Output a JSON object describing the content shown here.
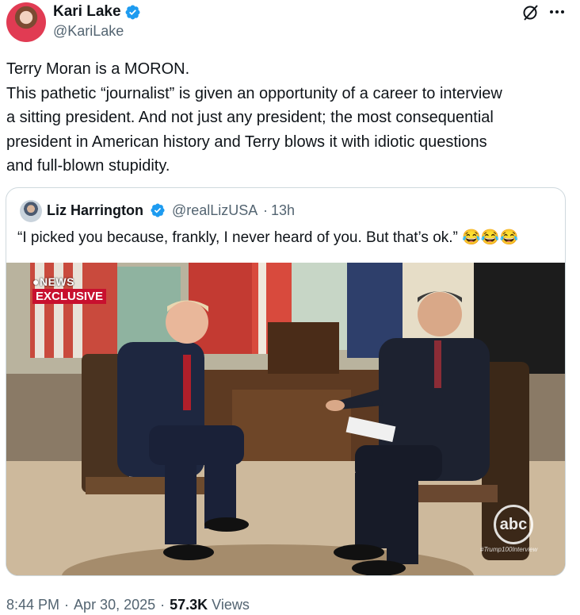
{
  "author": {
    "display_name": "Kari Lake",
    "handle": "@KariLake",
    "verified": true,
    "avatar_icon": "profile-photo"
  },
  "header_icons": [
    "grok-icon",
    "more-icon"
  ],
  "tweet": {
    "lines": [
      "Terry Moran is a MORON.",
      "This pathetic “journalist” is given an opportunity of a career to interview",
      "a sitting president. And not just any president; the most consequential",
      "president in American history and Terry blows it with idiotic questions",
      "and full-blown stupidity."
    ]
  },
  "quote": {
    "display_name": "Liz Harrington",
    "handle": "@realLizUSA",
    "separator": "·",
    "time": "13h",
    "text": "“I picked you because, frankly, I never heard of you. But that’s ok.”",
    "emojis": "😂😂😂",
    "video": {
      "network_logo": "NEWS",
      "banner": "EXCLUSIVE",
      "watermark": "abc",
      "hashtag": "#Trump100Interview"
    }
  },
  "meta": {
    "time": "8:44 PM",
    "separator": "·",
    "date": "Apr 30, 2025",
    "views_count": "57.3K",
    "views_label": "Views"
  },
  "colors": {
    "verified_badge": "#1d9bf0",
    "secondary_text": "#536471",
    "primary_text": "#0f1419",
    "border": "#cfd9de",
    "exclusive_red": "#c8102e"
  }
}
